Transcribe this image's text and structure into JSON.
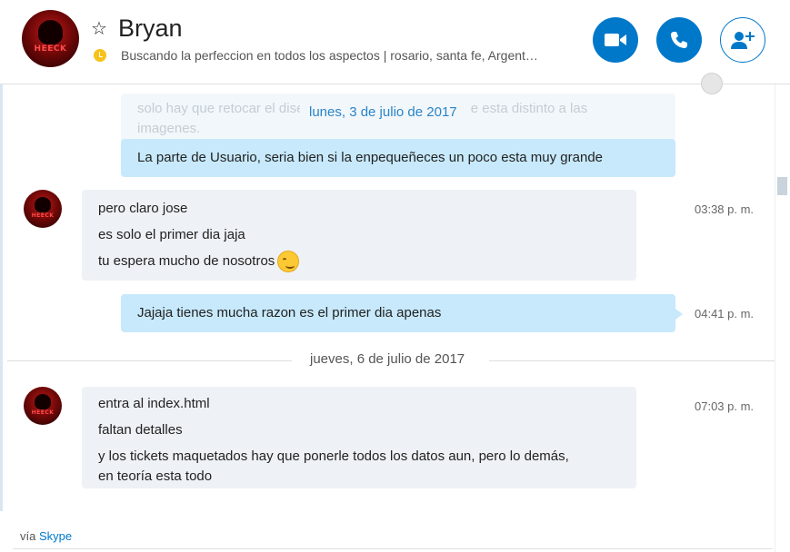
{
  "header": {
    "contact_name": "Bryan",
    "status_message": "Buscando la perfeccion en todos los aspectos  |  rosario, santa fe, Argent…",
    "avatar_label": "HEECK",
    "icons": {
      "favorite": "star-icon",
      "presence": "away-clock-icon",
      "video": "video-camera-icon",
      "call": "phone-icon",
      "add": "add-person-icon",
      "translator": "globe-icon"
    }
  },
  "colors": {
    "accent": "#0078ca",
    "outgoing_bubble": "#c7e9fb",
    "incoming_bubble": "#eef1f5",
    "away": "#f8c21a"
  },
  "chat": {
    "faded_message": {
      "line1": "solo hay que retocar el dise",
      "line1_end": "e esta distinto a las",
      "line2": "imagenes."
    },
    "date_1": "lunes, 3 de julio de 2017",
    "out_1": "La parte de Usuario, seria bien si la enpequeñeces un poco esta muy grande",
    "in_1": {
      "lines": [
        "pero claro jose",
        "es solo el primer dia jaja",
        "tu espera mucho de nosotros"
      ],
      "time": "03:38 p. m."
    },
    "out_2": {
      "text": "Jajaja tienes mucha razon es el primer dia apenas",
      "time": "04:41 p. m."
    },
    "date_2": "jueves, 6 de julio de 2017",
    "in_2": {
      "lines": [
        "entra al index.html",
        "faltan detalles",
        "y los tickets maquetados hay que ponerle todos los datos aun, pero lo demás,",
        "en teoría esta todo"
      ],
      "time": "07:03 p. m."
    }
  },
  "footer": {
    "via_label": "vía",
    "link_label": "Skype"
  }
}
